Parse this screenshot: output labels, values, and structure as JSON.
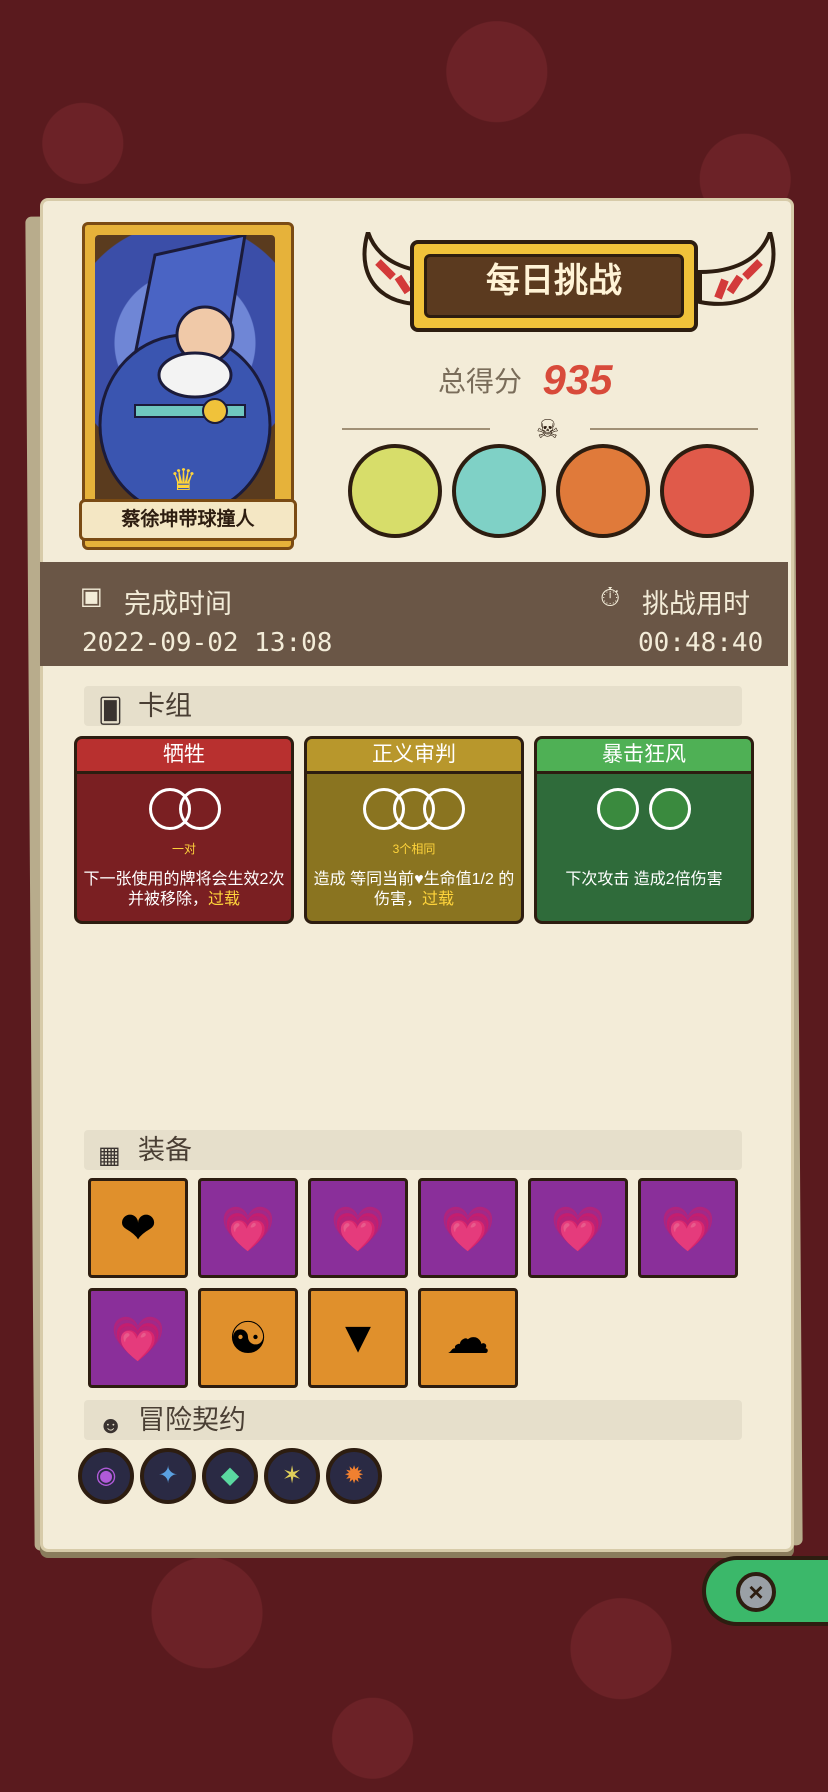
{
  "hero": {
    "name": "蔡徐坤带球撞人"
  },
  "header": {
    "title": "每日挑战",
    "score_label": "总得分",
    "score_value": "935"
  },
  "bosses": [
    {
      "name": "dinosaur-skeleton-boss-icon"
    },
    {
      "name": "green-beast-boss-icon"
    },
    {
      "name": "serpent-boss-icon"
    },
    {
      "name": "red-mask-boss-icon"
    }
  ],
  "info": {
    "finish_label": "完成时间",
    "finish_value": "2022-09-02 13:08",
    "duration_label": "挑战用时",
    "duration_value": "00:48:40"
  },
  "deck": {
    "title": "卡组",
    "cards": [
      {
        "title": "牺牲",
        "sub": "一对",
        "desc_a": "下一张使用的牌将会生效2次并被移除，",
        "desc_hl": "过载",
        "color": "#7a1f22",
        "head": "#b8302f"
      },
      {
        "title": "正义审判",
        "sub": "3个相同",
        "desc_a": "造成 等同当前♥生命值1/2 的伤害，",
        "desc_hl": "过载",
        "color": "#8a7420",
        "head": "#b8972c"
      },
      {
        "title": "暴击狂风",
        "sub": "",
        "desc_a": "下次攻击 造成2倍伤害",
        "desc_hl": "",
        "color": "#2f6b3a",
        "head": "#4fb055"
      }
    ]
  },
  "equipment": {
    "title": "装备",
    "items": [
      {
        "icon": "heart-chest-icon",
        "color": "#e0902c"
      },
      {
        "icon": "heart-amulet-icon",
        "color": "#8a2f9a"
      },
      {
        "icon": "heart-amulet-icon",
        "color": "#8a2f9a"
      },
      {
        "icon": "heart-amulet-icon",
        "color": "#8a2f9a"
      },
      {
        "icon": "heart-amulet-icon",
        "color": "#8a2f9a"
      },
      {
        "icon": "heart-amulet-icon",
        "color": "#8a2f9a"
      },
      {
        "icon": "heart-amulet-icon",
        "color": "#8a2f9a"
      },
      {
        "icon": "yin-yang-orb-icon",
        "color": "#e0902c"
      },
      {
        "icon": "triangle-rune-icon",
        "color": "#e0902c"
      },
      {
        "icon": "blue-mushroom-icon",
        "color": "#e0902c"
      }
    ]
  },
  "contracts": {
    "title": "冒险契约",
    "items": [
      {
        "icon": "purple-eye-contract-icon"
      },
      {
        "icon": "blue-claw-contract-icon"
      },
      {
        "icon": "green-crystal-contract-icon"
      },
      {
        "icon": "purple-star-contract-icon"
      },
      {
        "icon": "orange-flame-contract-icon"
      }
    ]
  }
}
